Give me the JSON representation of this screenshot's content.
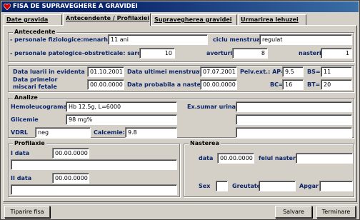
{
  "window": {
    "title": "FISA DE SUPRAVEGHERE A GRAVIDEI"
  },
  "tabs": [
    {
      "label": "Date gravida"
    },
    {
      "label": "Antecendente / Profilaxiei"
    },
    {
      "label": "Supravegherea gravidei"
    },
    {
      "label": "Urmarirea lehuzei"
    }
  ],
  "antecedente": {
    "title": "Antecedente",
    "fiziologice_label": "- personale fiziologice:menarha",
    "fiziologice_value": "11 ani",
    "ciclu_label": "ciclu menstrual",
    "ciclu_value": "regulat",
    "patologice_label": "- personale patologice-obstreticale: sarcini",
    "sarcini_value": "10",
    "avorturi_label": "avorturi",
    "avorturi_value": "8",
    "nasteri_label": "nasteri",
    "nasteri_value": "1"
  },
  "date_sarcina": {
    "luarii_label": "Data luarii in evidenta",
    "luarii_value": "01.10.2001",
    "menstruatii_label": "Data ultimei menstruatii",
    "menstruatii_value": "07.07.2001",
    "pelv_label": "Pelv.ext.: AP=",
    "pelv_value": "9.5",
    "bs_label": "BS=",
    "bs_value": "11",
    "miscari_label_1": "Data primelor",
    "miscari_label_2": "miscari fetale",
    "miscari_value": "00.00.0000",
    "nasterii_label": "Data probabila a nasterii",
    "nasterii_value": "00.00.0000",
    "bc_label": "BC=",
    "bc_value": "16",
    "bt_label": "BT=",
    "bt_value": "20"
  },
  "analize": {
    "title": "Analize",
    "hemo_label": "Hemoleucograma",
    "hemo_value": "Hb 12.5g, L=6000",
    "exsumar_label": "Ex.sumar urina",
    "exsumar_value": "",
    "glicemie_label": "Glicemie",
    "glicemie_value": "98 mg%",
    "vdrl_label": "VDRL",
    "vdrl_value": "neg",
    "calcemie_label": "Calcemie:",
    "calcemie_value": "9.8"
  },
  "profilaxie": {
    "title": "Profilaxie",
    "i_data_label": "I data",
    "i_data_value": "00.00.0000",
    "ii_data_label": "II data",
    "ii_data_value": "00.00.0000"
  },
  "nasterea": {
    "title": "Nasterea",
    "data_label": "data",
    "data_value": "00.00.0000",
    "fel_label": "felul nasterii",
    "sex_label": "Sex",
    "greutate_label": "Greutate",
    "apgar_label": "Apgar"
  },
  "buttons": {
    "tiparire": "Tiparire fisa",
    "salvare": "Salvare",
    "terminare": "Terminare"
  },
  "colors": {
    "label": "#0a246a",
    "titlebar": "#0a246a",
    "face": "#d4d0c8"
  }
}
